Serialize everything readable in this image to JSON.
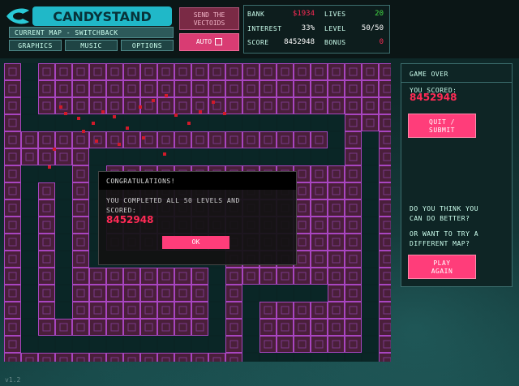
{
  "logo": {
    "text": "CANDYSTAND"
  },
  "header": {
    "current_map": "CURRENT MAP - SWITCHBACK",
    "menu": [
      {
        "label": "GRAPHICS"
      },
      {
        "label": "MUSIC"
      },
      {
        "label": "OPTIONS"
      }
    ],
    "send_label_1": "SEND THE",
    "send_label_2": "VECTOIDS",
    "auto_label": "AUTO"
  },
  "stats": {
    "bank_label": "BANK",
    "bank": "$1934",
    "lives_label": "LIVES",
    "lives": "20",
    "interest_label": "INTEREST",
    "interest": "33%",
    "level_label": "LEVEL",
    "level": "50/50",
    "score_label": "SCORE",
    "score": "8452948",
    "bonus_label": "BONUS",
    "bonus": "0"
  },
  "colors": {
    "bank": "#ff2a55",
    "lives": "#44dd44",
    "bonus": "#ff2a55",
    "accent_pink": "#ff3d7a"
  },
  "sidebar": {
    "title": "GAME OVER",
    "scored_label": "YOU SCORED:",
    "score": "8452948",
    "quit_line1": "QUIT /",
    "quit_line2": "SUBMIT",
    "prompt1_line1": "DO YOU THINK YOU",
    "prompt1_line2": "CAN DO BETTER?",
    "prompt2_line1": "OR WANT TO TRY A",
    "prompt2_line2": "DIFFERENT MAP?",
    "play_line1": "PLAY",
    "play_line2": "AGAIN"
  },
  "dialog": {
    "title": "CONGRATULATIONS!",
    "message_line1": "YOU COMPLETED ALL 50 LEVELS AND",
    "message_line2": "SCORED:",
    "score": "8452948",
    "ok_label": "OK"
  },
  "version": "v1.2"
}
